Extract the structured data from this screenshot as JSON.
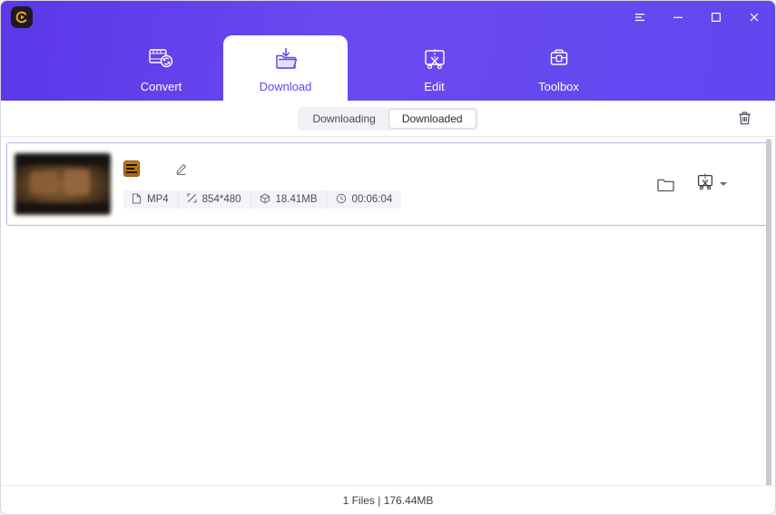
{
  "window": {
    "logo_icon": "app-logo-c-play",
    "controls": [
      {
        "name": "menu-button",
        "icon": "hamburger-icon"
      },
      {
        "name": "minimize-button",
        "icon": "minimize-icon"
      },
      {
        "name": "maximize-button",
        "icon": "maximize-icon"
      },
      {
        "name": "close-button",
        "icon": "close-icon"
      }
    ],
    "accent_color": "#6246ee",
    "accent_gradient_from": "#5b37e8",
    "accent_gradient_to": "#6246ee"
  },
  "tabs": [
    {
      "label": "Convert",
      "icon": "film-convert-icon",
      "active": false
    },
    {
      "label": "Download",
      "icon": "folder-download-icon",
      "active": true
    },
    {
      "label": "Edit",
      "icon": "screen-scissors-icon",
      "active": false
    },
    {
      "label": "Toolbox",
      "icon": "toolbox-icon",
      "active": false
    }
  ],
  "subbar": {
    "segments": [
      {
        "label": "Downloading",
        "selected": false
      },
      {
        "label": "Downloaded",
        "selected": true
      }
    ],
    "delete_icon": "trash-icon"
  },
  "list": {
    "items": [
      {
        "title": "",
        "title_redacted": true,
        "favicon": "site-favicon",
        "thumbnail": "video-thumbnail",
        "edit_title_icon": "pencil-icon",
        "meta": [
          {
            "icon": "file-icon",
            "value": "MP4"
          },
          {
            "icon": "resolution-icon",
            "value": "854*480"
          },
          {
            "icon": "filesize-icon",
            "value": "18.41MB"
          },
          {
            "icon": "clock-icon",
            "value": "00:06:04"
          }
        ],
        "actions": [
          {
            "name": "open-folder-button",
            "icon": "folder-icon"
          },
          {
            "name": "edit-video-button",
            "icon": "screen-scissors-icon",
            "has_dropdown": true
          }
        ]
      }
    ]
  },
  "footer": {
    "status": "1 Files | 176.44MB"
  }
}
